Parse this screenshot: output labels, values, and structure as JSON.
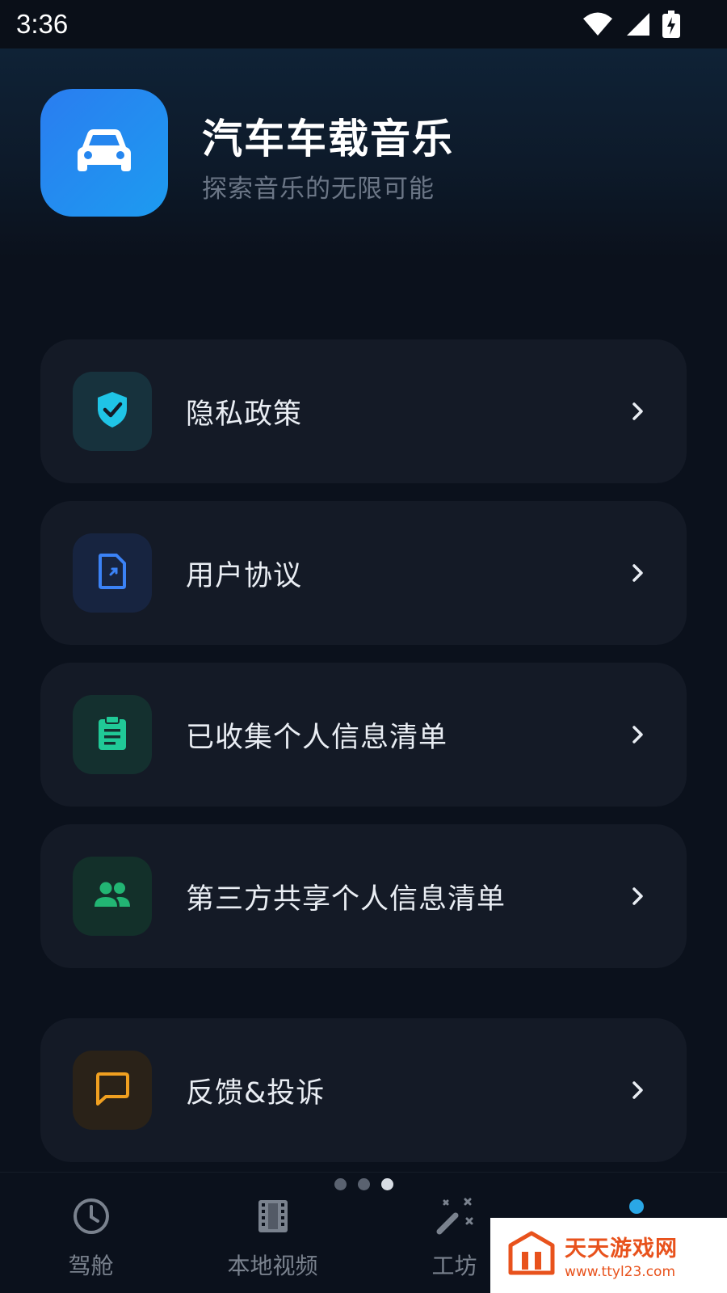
{
  "status_bar": {
    "time": "3:36",
    "icons": [
      "wifi-icon",
      "signal-icon",
      "battery-charging-icon"
    ]
  },
  "header": {
    "app_icon": "car-icon",
    "title": "汽车车载音乐",
    "subtitle": "探索音乐的无限可能",
    "accent_color": "#2a86f0"
  },
  "menu": [
    {
      "label": "隐私政策",
      "icon": "shield-check-icon",
      "color": "#1fc4e6"
    },
    {
      "label": "用户协议",
      "icon": "document-icon",
      "color": "#3b82f6"
    },
    {
      "label": "已收集个人信息清单",
      "icon": "clipboard-icon",
      "color": "#20c997"
    },
    {
      "label": "第三方共享个人信息清单",
      "icon": "people-icon",
      "color": "#22b573"
    },
    {
      "label": "反馈&投诉",
      "icon": "message-icon",
      "color": "#f0a020"
    }
  ],
  "pager": {
    "count": 3,
    "active": 3
  },
  "bottom_nav": [
    {
      "label": "驾舱",
      "icon": "clock-icon",
      "active": false
    },
    {
      "label": "本地视频",
      "icon": "film-icon",
      "active": false
    },
    {
      "label": "工坊",
      "icon": "magic-wand-icon",
      "active": false
    },
    {
      "label": "",
      "icon": "person-icon",
      "active": true
    }
  ],
  "watermark": {
    "title": "天天游戏网",
    "url": "www.ttyl23.com"
  }
}
